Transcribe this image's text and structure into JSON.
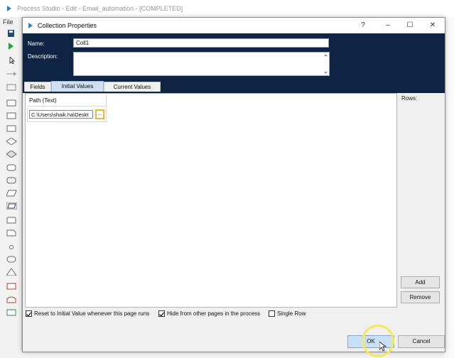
{
  "app": {
    "title": "Process Studio - Edit - Email_automation - [COMPLETED]",
    "file_menu": "File"
  },
  "dialog": {
    "title": "Collection Properties",
    "controls": {
      "help": "?",
      "minimize": "–",
      "maximize": "☐",
      "close": "✕"
    },
    "name_label": "Name:",
    "name_value": "Coll1",
    "description_label": "Description:",
    "description_value": "",
    "tabs": [
      {
        "label": "Fields",
        "active": false
      },
      {
        "label": "Initial Values",
        "active": true
      },
      {
        "label": "Current Values",
        "active": false
      }
    ],
    "grid": {
      "column_header": "Path  (Text)",
      "rows": [
        {
          "value": "C:\\Users\\shaik.ha\\Deskt",
          "button_label": "..."
        }
      ]
    },
    "rows_label": "Rows:",
    "add_button": "Add",
    "remove_button": "Remove",
    "options": [
      {
        "label": "Reset to Initial Value whenever this page runs",
        "checked": true
      },
      {
        "label": "Hide from other pages in the process",
        "checked": true
      },
      {
        "label": "Single Row",
        "checked": false
      }
    ],
    "ok_button": "OK",
    "cancel_button": "Cancel"
  },
  "colors": {
    "header_panel": "#0f2442",
    "active_tab": "#cfe0f3",
    "ok_button": "#c9dff3",
    "cell_button_border": "#f0b632",
    "highlight": "#f4ea5a"
  }
}
